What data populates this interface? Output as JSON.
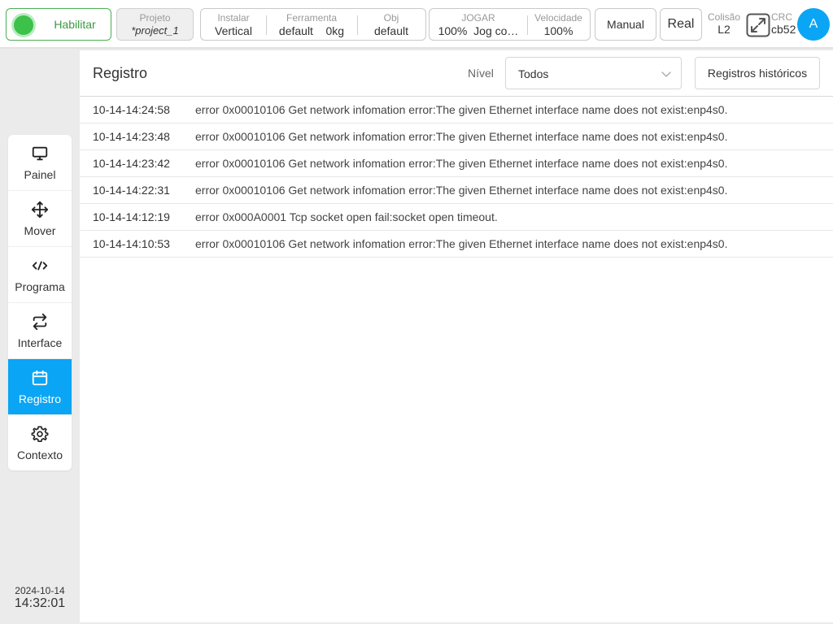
{
  "topbar": {
    "enable_label": "Habilitar",
    "project": {
      "caption": "Projeto",
      "value": "*project_1"
    },
    "install": {
      "caption": "Instalar",
      "value": "Vertical"
    },
    "tool": {
      "caption": "Ferramenta",
      "name": "default",
      "load": "0kg"
    },
    "obj": {
      "caption": "Obj",
      "value": "default"
    },
    "jog": {
      "caption": "JOGAR",
      "percent": "100%",
      "mode": "Jog co…"
    },
    "speed": {
      "caption": "Velocidade",
      "value": "100%"
    },
    "manual_label": "Manual",
    "real_label": "Real",
    "collision": {
      "caption": "Colisão",
      "value": "L2"
    },
    "crc": {
      "caption": "CRC",
      "value": "cb52"
    },
    "avatar_letter": "A"
  },
  "sidebar": {
    "items": [
      {
        "label": "Painel",
        "icon": "monitor-icon"
      },
      {
        "label": "Mover",
        "icon": "move-arrows-icon"
      },
      {
        "label": "Programa",
        "icon": "code-icon"
      },
      {
        "label": "Interface",
        "icon": "swap-arrows-icon"
      },
      {
        "label": "Registro",
        "icon": "calendar-icon",
        "active": true
      },
      {
        "label": "Contexto",
        "icon": "gear-icon"
      }
    ],
    "date": "2024-10-14",
    "time": "14:32:01"
  },
  "log": {
    "title": "Registro",
    "level_label": "Nível",
    "level_value": "Todos",
    "history_label": "Registros históricos",
    "rows": [
      {
        "time": "10-14-14:24:58",
        "message": "error  0x00010106 Get network infomation error:The given Ethernet interface name does not exist:enp4s0."
      },
      {
        "time": "10-14-14:23:48",
        "message": "error  0x00010106 Get network infomation error:The given Ethernet interface name does not exist:enp4s0."
      },
      {
        "time": "10-14-14:23:42",
        "message": "error  0x00010106 Get network infomation error:The given Ethernet interface name does not exist:enp4s0."
      },
      {
        "time": "10-14-14:22:31",
        "message": "error  0x00010106 Get network infomation error:The given Ethernet interface name does not exist:enp4s0."
      },
      {
        "time": "10-14-14:12:19",
        "message": "error  0x000A0001 Tcp socket open fail:socket open timeout."
      },
      {
        "time": "10-14-14:10:53",
        "message": "error  0x00010106 Get network infomation error:The given Ethernet interface name does not exist:enp4s0."
      }
    ]
  },
  "colors": {
    "accent": "#0aa5f5",
    "enable_green": "#3cc14a",
    "enable_text": "#3c9a42"
  }
}
